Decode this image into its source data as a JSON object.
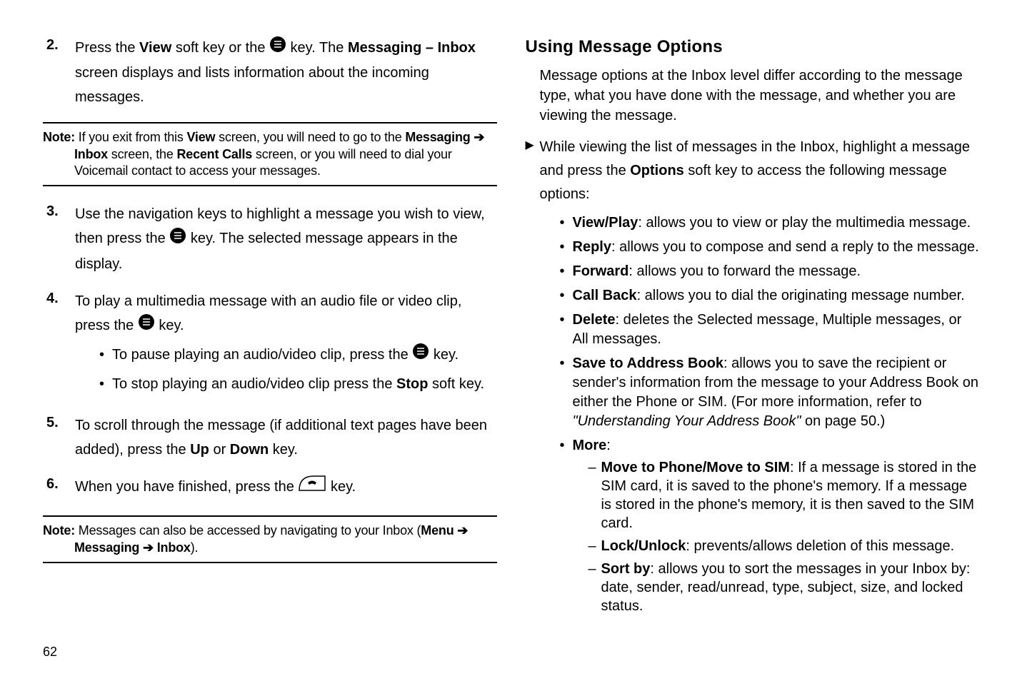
{
  "left": {
    "step2": {
      "num": "2.",
      "t1": "Press the ",
      "view": "View",
      "t2": " soft key or the ",
      "t3": " key. The ",
      "msg": "Messaging – Inbox",
      "t4": " screen displays and lists information about the incoming messages."
    },
    "note1": {
      "label": "Note:",
      "t1": " If you exit from this ",
      "view": "View",
      "t2": " screen, you will need to go to the ",
      "msg": "Messaging",
      "arrow1": " ➔ ",
      "inbox": "Inbox",
      "t3": " screen, the ",
      "recent": "Recent Calls",
      "t4": " screen, or you will need to dial your Voicemail contact to access your messages."
    },
    "step3": {
      "num": "3.",
      "t1": "Use the navigation keys to highlight a message you wish to view, then press the ",
      "t2": " key. The selected message appears in the display."
    },
    "step4": {
      "num": "4.",
      "t1": "To play a multimedia message with an audio file or video clip, press the ",
      "t2": " key.",
      "sub1a": "To pause playing an audio/video clip, press the ",
      "sub1b": " key.",
      "sub2a": "To stop playing an audio/video clip press the ",
      "sub2b": "Stop",
      "sub2c": " soft key."
    },
    "step5": {
      "num": "5.",
      "t1": "To scroll through the message (if additional text pages have been added), press the ",
      "up": "Up",
      "or": " or ",
      "down": "Down",
      "t2": " key."
    },
    "step6": {
      "num": "6.",
      "t1": "When you have finished, press the ",
      "t2": " key."
    },
    "note2": {
      "label": "Note:",
      "t1": " Messages can also be accessed by navigating to your Inbox (",
      "menu": "Menu",
      "arrow1": " ➔ ",
      "messaging": "Messaging",
      "arrow2": " ➔ ",
      "inbox": "Inbox",
      "t2": ")."
    }
  },
  "right": {
    "heading": "Using Message Options",
    "intro": "Message options at the Inbox level differ according to the message type, what you have done with the message, and whether you are viewing the message.",
    "tri": {
      "t1": "While viewing the list of messages in the Inbox, highlight a message and press the ",
      "options": "Options",
      "t2": " soft key to access the following message options:"
    },
    "opts": {
      "viewplay_label": "View/Play",
      "viewplay_text": ": allows you to view or play the multimedia message.",
      "reply_label": "Reply",
      "reply_text": ": allows you to compose and send a reply to the message.",
      "forward_label": "Forward",
      "forward_text": ": allows you to forward the message.",
      "callback_label": "Call Back",
      "callback_text": ": allows you to dial the originating message number.",
      "delete_label": "Delete",
      "delete_text": ": deletes the Selected message, Multiple messages, or All messages.",
      "save_label": "Save to Address Book",
      "save_text1": ": allows you to save the recipient or sender's information from the message to your Address Book on either the Phone or SIM. (For more information, refer to ",
      "save_ref": "\"Understanding Your Address Book\"",
      "save_text2": "  on page 50.)",
      "more_label": "More",
      "more_colon": ":"
    },
    "more": {
      "move_label": "Move to Phone/Move to SIM",
      "move_text": ": If a message is stored in the SIM card, it is saved to the phone's memory. If a message is stored in the phone's memory, it is then saved to the SIM card.",
      "lock_label": "Lock/Unlock",
      "lock_text": ": prevents/allows deletion of this message.",
      "sort_label": "Sort by",
      "sort_text": ": allows you to sort the messages in your Inbox by: date, sender, read/unread, type, subject, size, and locked status."
    }
  },
  "page": "62"
}
